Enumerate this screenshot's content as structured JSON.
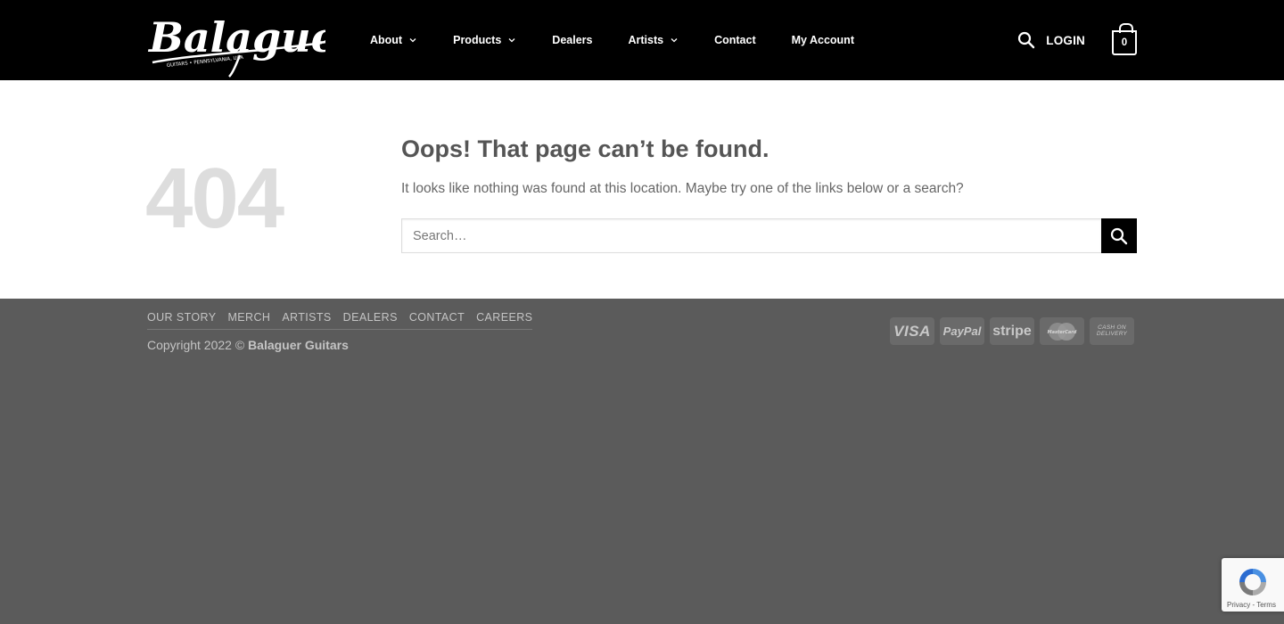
{
  "header": {
    "logo": {
      "main": "Balaguer",
      "tagline": "GUITARS • PENNSYLVANIA, USA"
    },
    "nav": [
      {
        "label": "About",
        "has_dropdown": true
      },
      {
        "label": "Products",
        "has_dropdown": true
      },
      {
        "label": "Dealers",
        "has_dropdown": false
      },
      {
        "label": "Artists",
        "has_dropdown": true
      },
      {
        "label": "Contact",
        "has_dropdown": false
      },
      {
        "label": "My Account",
        "has_dropdown": false
      }
    ],
    "login_label": "LOGIN",
    "cart_count": "0"
  },
  "main": {
    "error_code": "404",
    "title": "Oops! That page can’t be found.",
    "message": "It looks like nothing was found at this location. Maybe try one of the links below or a search?",
    "search_placeholder": "Search…"
  },
  "footer": {
    "links": [
      "OUR STORY",
      "MERCH",
      "ARTISTS",
      "DEALERS",
      "CONTACT",
      "CAREERS"
    ],
    "copyright_prefix": "Copyright 2022 © ",
    "copyright_brand": "Balaguer Guitars",
    "payments": {
      "visa": "VISA",
      "paypal": "PayPal",
      "stripe": "stripe",
      "mastercard": "MasterCard",
      "cod_line1": "CASH ON",
      "cod_line2": "DELIVERY"
    }
  },
  "recaptcha": {
    "links": "Privacy - Terms"
  },
  "colors": {
    "header_bg": "#000000",
    "footer_bg": "#5b5b5b",
    "error_code": "#dddddd",
    "title_text": "#555555"
  }
}
